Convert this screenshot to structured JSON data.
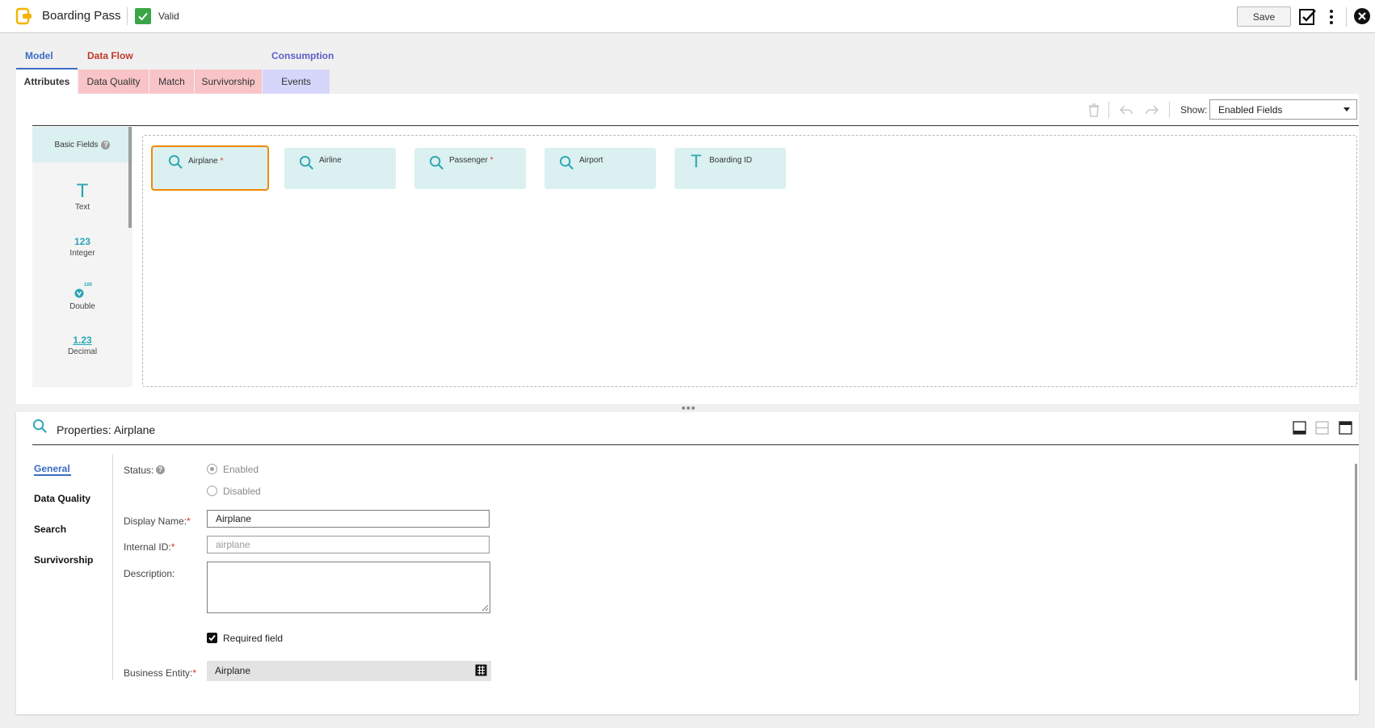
{
  "header": {
    "title": "Boarding Pass",
    "status": "Valid",
    "save_label": "Save"
  },
  "groups": {
    "model": "Model",
    "data_flow": "Data Flow",
    "consumption": "Consumption"
  },
  "tabs": [
    {
      "label": "Attributes",
      "color": "#ffffff",
      "active": true
    },
    {
      "label": "Data Quality",
      "color": "#f8c4c8"
    },
    {
      "label": "Match",
      "color": "#f8c4c8"
    },
    {
      "label": "Survivorship",
      "color": "#f8c4c8"
    },
    {
      "label": "Events",
      "color": "#d6d6fa"
    }
  ],
  "toolbar": {
    "show_label": "Show:",
    "show_value": "Enabled Fields",
    "icons": [
      "trash-icon",
      "undo-icon",
      "redo-icon"
    ]
  },
  "palette": {
    "heading": "Basic Fields",
    "help": "?",
    "items": [
      {
        "glyph": "T",
        "label": "Text",
        "icon": "text-type-icon"
      },
      {
        "glyph": "123",
        "label": "Integer",
        "icon": "integer-type-icon"
      },
      {
        "glyph": "100",
        "label": "Double",
        "icon": "double-type-icon"
      },
      {
        "glyph": "1.23",
        "label": "Decimal",
        "icon": "decimal-type-icon"
      }
    ]
  },
  "fields": [
    {
      "name": "Airplane",
      "required": true,
      "icon": "search-icon",
      "selected": true
    },
    {
      "name": "Airline",
      "required": false,
      "icon": "search-icon"
    },
    {
      "name": "Passenger",
      "required": true,
      "icon": "search-icon"
    },
    {
      "name": "Airport",
      "required": false,
      "icon": "search-icon"
    },
    {
      "name": "Boarding ID",
      "required": false,
      "icon": "text-type-icon"
    }
  ],
  "properties": {
    "title": "Properties: Airplane",
    "nav": [
      "General",
      "Data Quality",
      "Search",
      "Survivorship"
    ],
    "status_label": "Status:",
    "help": "?",
    "enabled_label": "Enabled",
    "disabled_label": "Disabled",
    "display_name_label": "Display Name:",
    "display_name_value": "Airplane",
    "internal_id_label": "Internal ID:",
    "internal_id_value": "airplane",
    "description_label": "Description:",
    "description_value": "",
    "required_label": "Required field",
    "business_entity_label": "Business Entity:",
    "business_entity_value": "Airplane",
    "required_marker": "*"
  },
  "colors": {
    "accent": "#3b6cc4",
    "data_flow": "#c0392b",
    "consumption": "#5a5fc8",
    "teal": "#2aa6b3",
    "selected_border": "#f08a00",
    "valid": "#3aa547"
  }
}
